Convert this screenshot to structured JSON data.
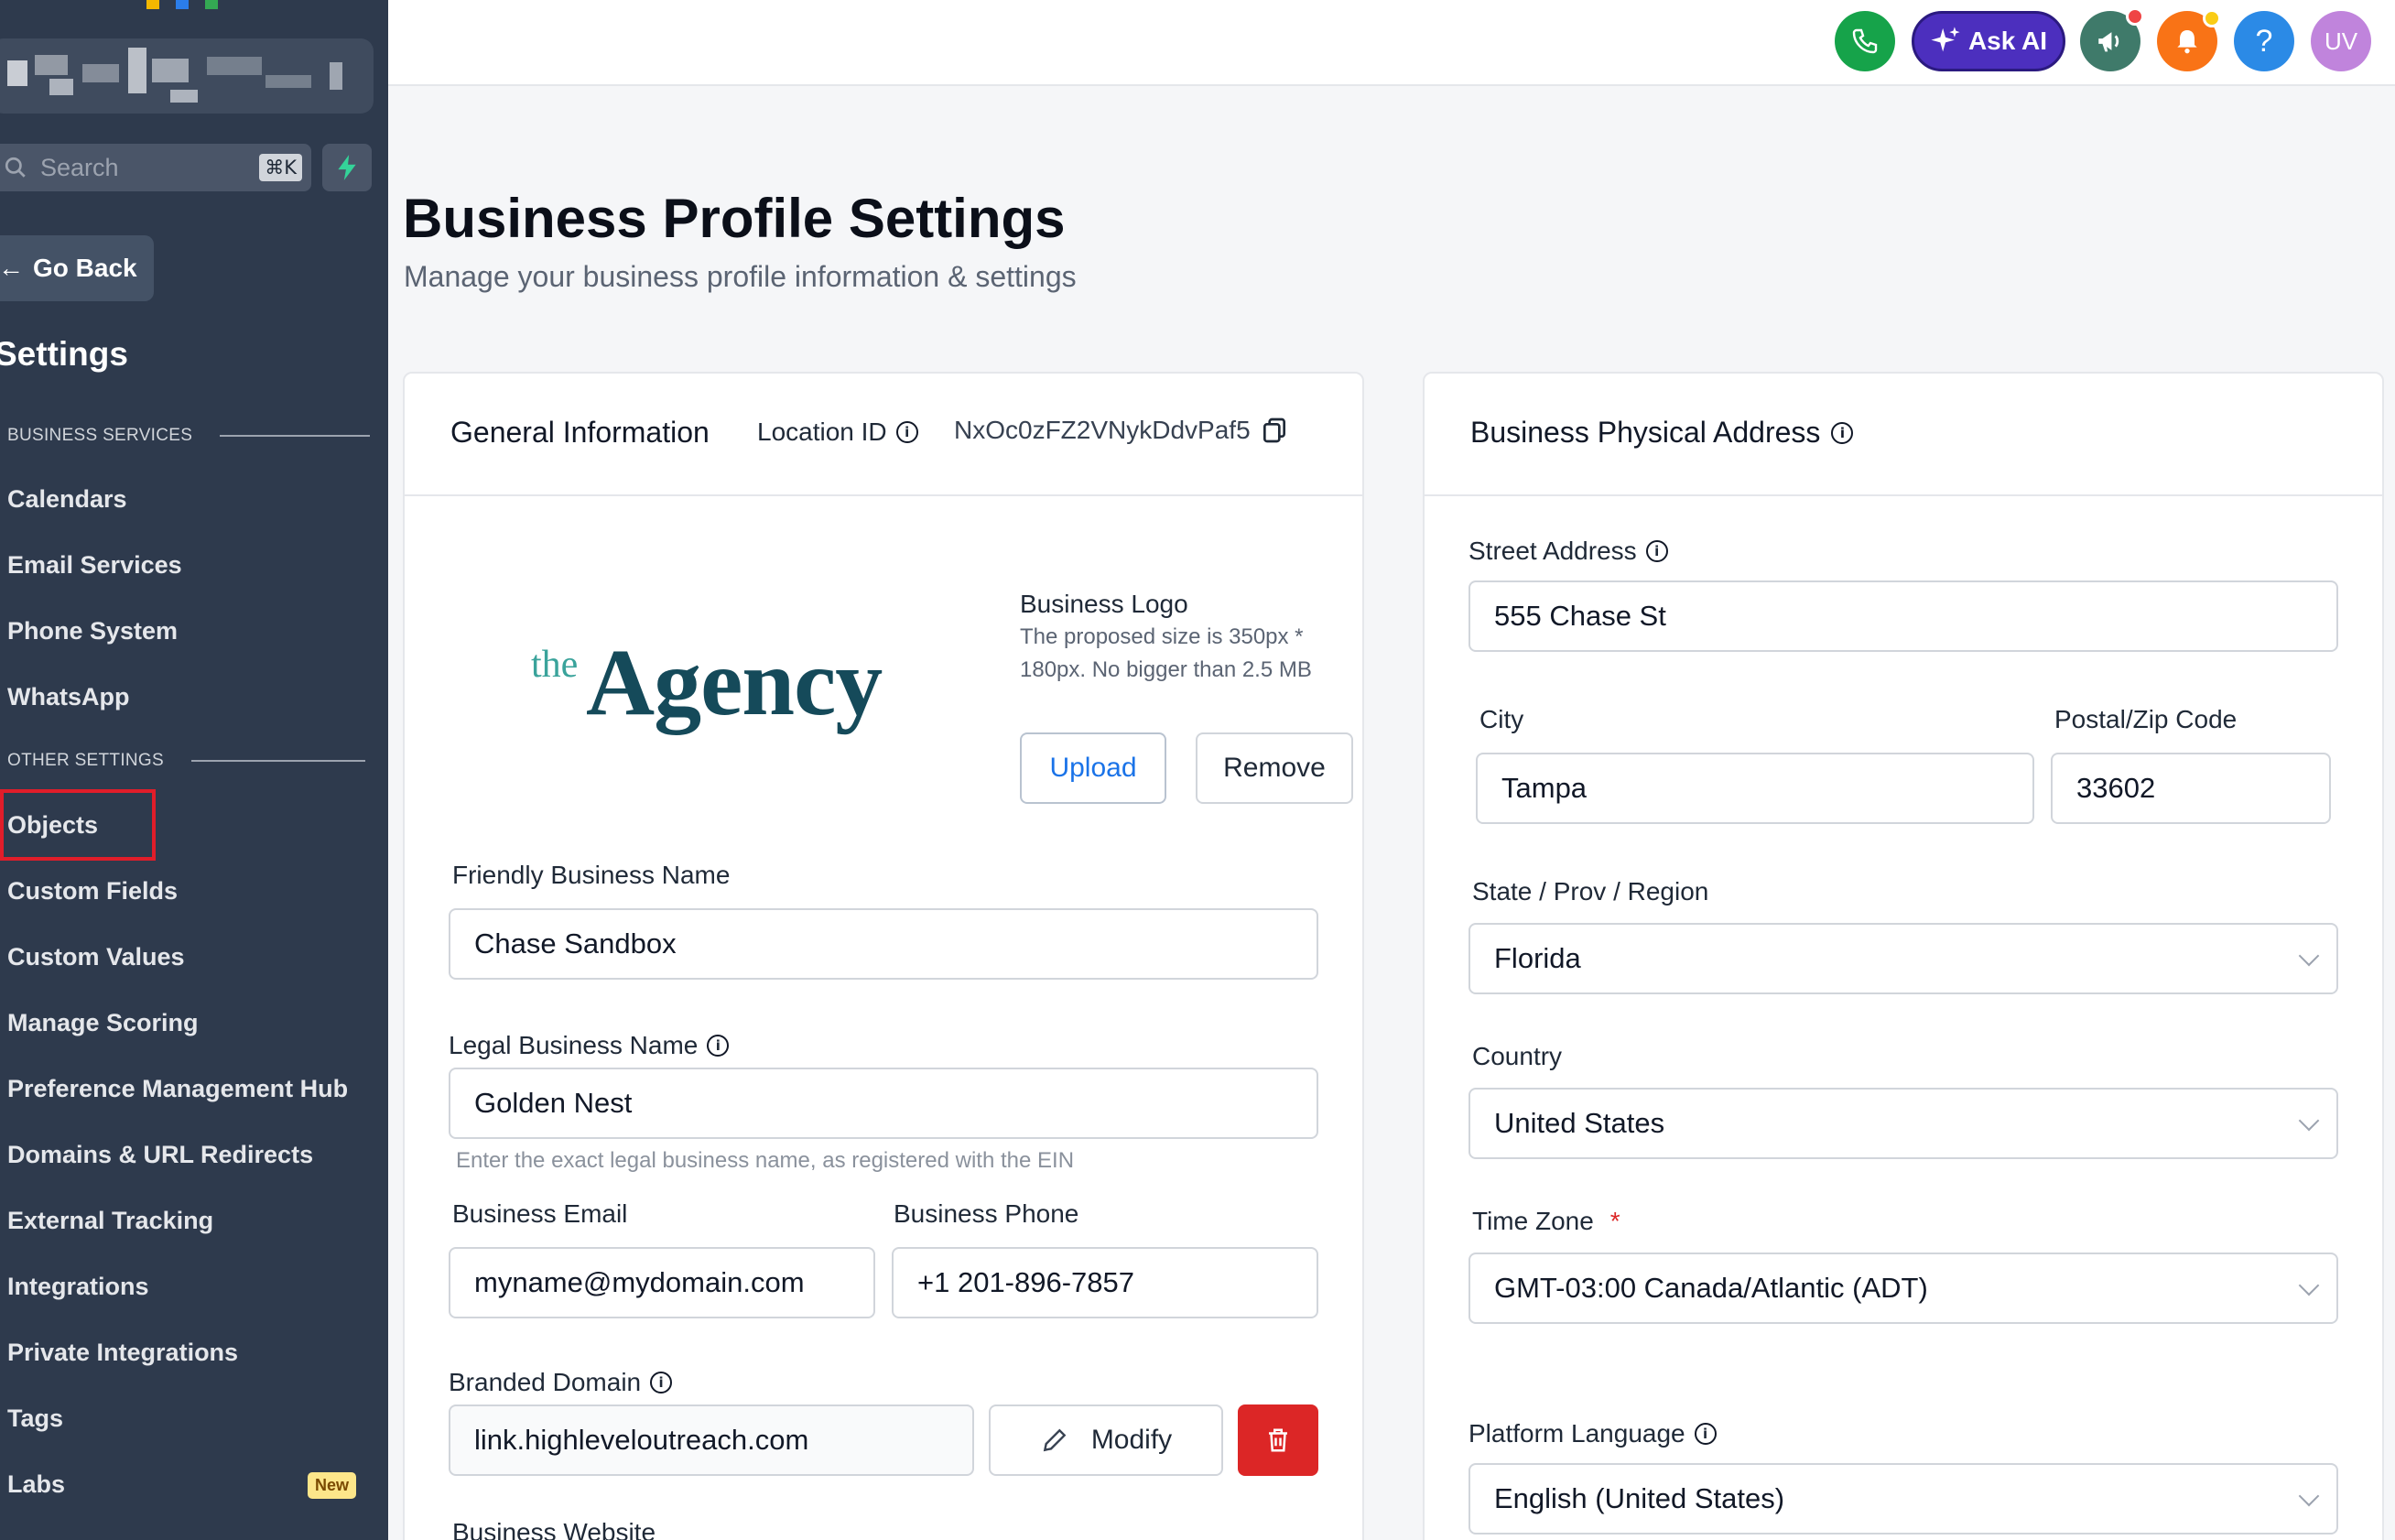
{
  "sidebar": {
    "search_placeholder": "Search",
    "search_shortcut": "⌘K",
    "go_back": "Go Back",
    "settings_title": "Settings",
    "section_business": "BUSINESS SERVICES",
    "section_other": "OTHER SETTINGS",
    "business_items": [
      "Calendars",
      "Email Services",
      "Phone System",
      "WhatsApp"
    ],
    "other_items": [
      "Objects",
      "Custom Fields",
      "Custom Values",
      "Manage Scoring",
      "Preference Management Hub",
      "Domains & URL Redirects",
      "External Tracking",
      "Integrations",
      "Private Integrations",
      "Tags",
      "Labs"
    ],
    "labs_badge": "New"
  },
  "topbar": {
    "ask_ai": "Ask AI",
    "help": "?",
    "avatar": "UV",
    "colors": {
      "phone": "#16a34a",
      "askai": "#4c2fbe",
      "announce": "#3f7a6a",
      "notify": "#f97316",
      "help": "#2b8ae6",
      "avatar": "#c084dc"
    }
  },
  "page": {
    "title": "Business Profile Settings",
    "subtitle": "Manage your business profile information & settings"
  },
  "general": {
    "title": "General Information",
    "location_label": "Location ID",
    "location_id": "NxOc0zFZ2VNykDdvPaf5",
    "logo_the": "the",
    "logo_agency": "Agency",
    "logo_label": "Business Logo",
    "logo_hint_1": "The proposed size is 350px *",
    "logo_hint_2": "180px. No bigger than 2.5 MB",
    "upload": "Upload",
    "remove": "Remove",
    "friendly_label": "Friendly Business Name",
    "friendly_value": "Chase Sandbox",
    "legal_label": "Legal Business Name",
    "legal_value": "Golden Nest",
    "legal_hint": "Enter the exact legal business name, as registered with the EIN",
    "email_label": "Business Email",
    "email_value": "myname@mydomain.com",
    "phone_label": "Business Phone",
    "phone_value": "+1 201-896-7857",
    "domain_label": "Branded Domain",
    "domain_value": "link.highleveloutreach.com",
    "modify": "Modify",
    "website_label": "Business Website"
  },
  "address": {
    "title": "Business Physical Address",
    "street_label": "Street Address",
    "street_value": "555 Chase St",
    "city_label": "City",
    "city_value": "Tampa",
    "zip_label": "Postal/Zip Code",
    "zip_value": "33602",
    "state_label": "State / Prov / Region",
    "state_value": "Florida",
    "country_label": "Country",
    "country_value": "United States",
    "tz_label": "Time Zone",
    "tz_required": "*",
    "tz_value": "GMT-03:00 Canada/Atlantic (ADT)",
    "lang_label": "Platform Language",
    "lang_value": "English (United States)"
  }
}
